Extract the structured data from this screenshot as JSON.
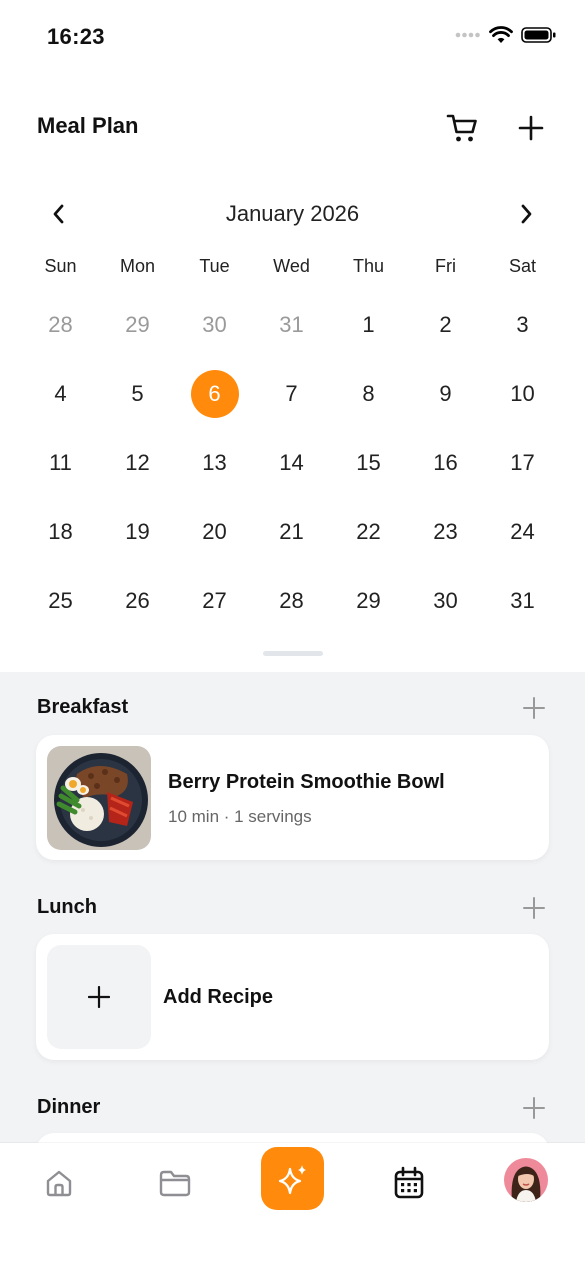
{
  "status_bar": {
    "time": "16:23"
  },
  "header": {
    "title": "Meal Plan"
  },
  "calendar": {
    "month_label": "January 2026",
    "weekdays": [
      "Sun",
      "Mon",
      "Tue",
      "Wed",
      "Thu",
      "Fri",
      "Sat"
    ],
    "weeks": [
      [
        "28",
        "29",
        "30",
        "31",
        "1",
        "2",
        "3"
      ],
      [
        "4",
        "5",
        "6",
        "7",
        "8",
        "9",
        "10"
      ],
      [
        "11",
        "12",
        "13",
        "14",
        "15",
        "16",
        "17"
      ],
      [
        "18",
        "19",
        "20",
        "21",
        "22",
        "23",
        "24"
      ],
      [
        "25",
        "26",
        "27",
        "28",
        "29",
        "30",
        "31"
      ]
    ],
    "muted_days": [
      "28",
      "29",
      "30",
      "31"
    ],
    "selected_day": "6"
  },
  "meals": {
    "breakfast": {
      "title": "Breakfast",
      "recipe_name": "Berry Protein Smoothie Bowl",
      "recipe_meta": "10 min · 1 servings"
    },
    "lunch": {
      "title": "Lunch",
      "add_label": "Add Recipe"
    },
    "dinner": {
      "title": "Dinner"
    }
  },
  "colors": {
    "accent": "#ff8a0c",
    "section_background": "#f2f3f5"
  },
  "tabbar": {
    "icons": [
      "home-icon",
      "folder-icon",
      "sparkle-icon",
      "calendar-icon",
      "avatar"
    ],
    "active": "calendar-icon"
  }
}
